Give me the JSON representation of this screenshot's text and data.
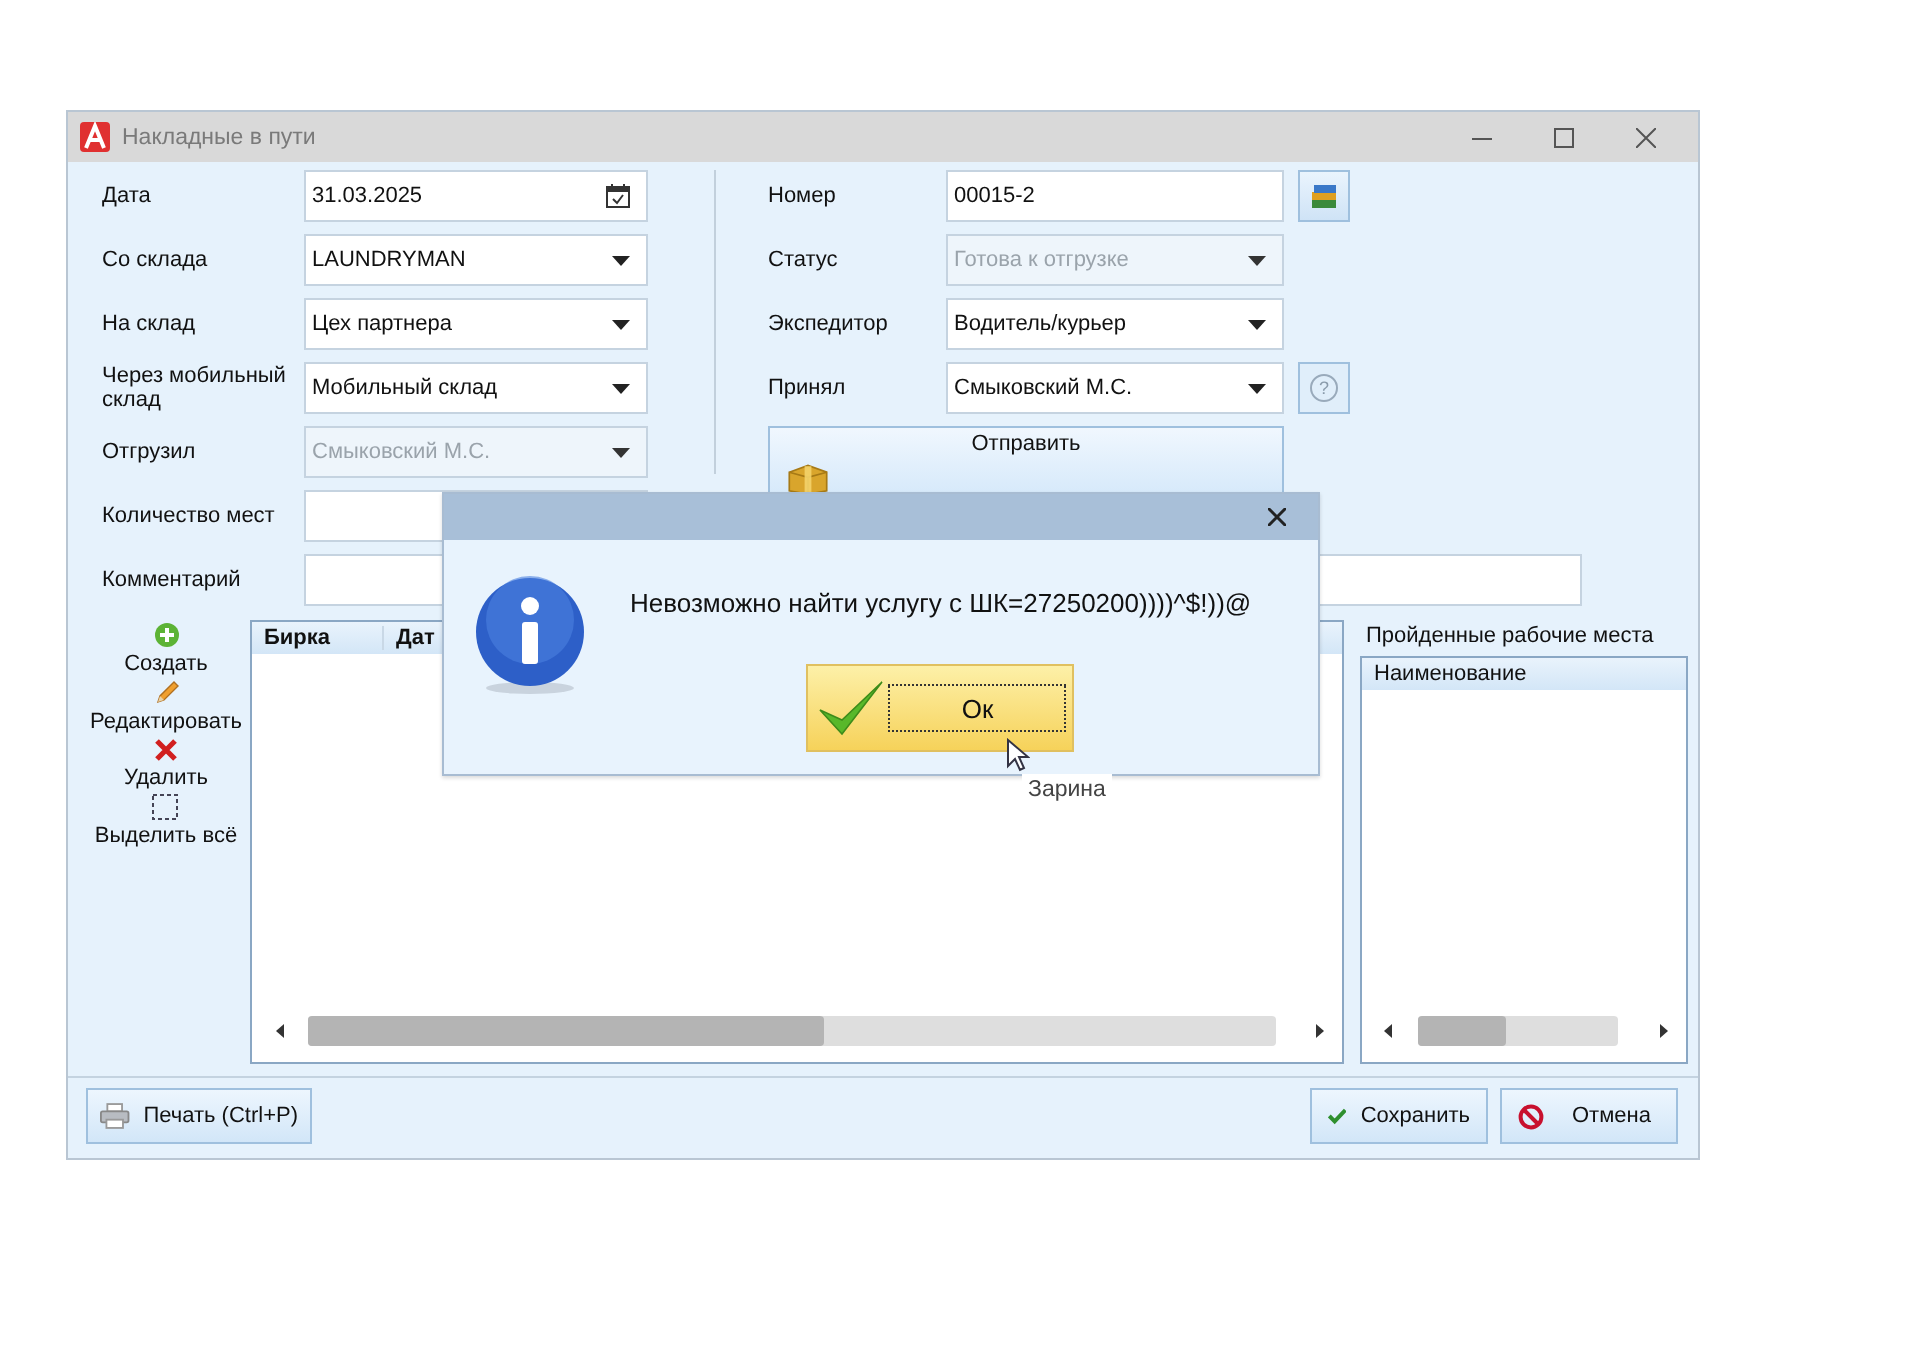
{
  "window": {
    "title": "Накладные в пути"
  },
  "left_fields": [
    {
      "label": "Дата",
      "kind": "date",
      "value": "31.03.2025",
      "disabled": false
    },
    {
      "label": "Со склада",
      "kind": "combo",
      "value": "LAUNDRYMAN",
      "disabled": false
    },
    {
      "label": "На склад",
      "kind": "combo",
      "value": "Цех партнера",
      "disabled": false
    },
    {
      "label": "Через мобильный склад",
      "kind": "combo",
      "value": "Мобильный склад",
      "disabled": false
    },
    {
      "label": "Отгрузил",
      "kind": "combo",
      "value": "Смыковский М.С.",
      "disabled": true
    },
    {
      "label": "Количество мест",
      "kind": "text",
      "disabled": false
    }
  ],
  "right_fields": [
    {
      "label": "Номер",
      "kind": "text",
      "value": "00015-2",
      "disabled": false,
      "side_button": {
        "kind": "books"
      }
    },
    {
      "label": "Статус",
      "kind": "combo",
      "value": "Готова к отгрузке",
      "disabled": true
    },
    {
      "label": "Экспедитор",
      "kind": "combo",
      "value": "Водитель/курьер",
      "disabled": false
    },
    {
      "label": "Принял",
      "kind": "combo",
      "value": "Смыковский М.С.",
      "disabled": false,
      "side_button": {
        "kind": "help",
        "symbol": "?"
      }
    }
  ],
  "send_button": {
    "label": "Отправить"
  },
  "comment": {
    "label": "Комментарий"
  },
  "toolbar": [
    {
      "label": "Создать",
      "kind": "create"
    },
    {
      "label": "Редактировать",
      "kind": "edit"
    },
    {
      "label": "Удалить",
      "kind": "delete"
    },
    {
      "label": "Выделить всё",
      "kind": "select_all"
    }
  ],
  "table": {
    "columns": [
      "Бирка",
      "Дат"
    ]
  },
  "panel": {
    "title": "Пройденные рабочие места",
    "columns": [
      "Наименование"
    ]
  },
  "footer_buttons": [
    {
      "label": "Печать (Ctrl+P)",
      "kind": "print"
    },
    {
      "label": "Сохранить",
      "kind": "save"
    },
    {
      "label": "Отмена",
      "kind": "cancel"
    }
  ],
  "dialog": {
    "message": "Невозможно найти услугу с ШК=27250200))))^$!))@",
    "button": "Ок"
  },
  "tooltip": "Зарина"
}
